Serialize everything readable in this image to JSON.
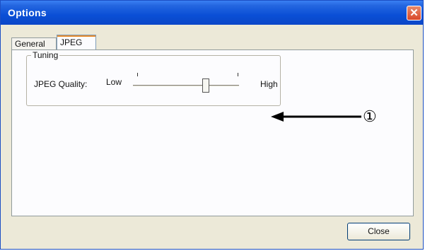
{
  "window": {
    "title": "Options",
    "close_glyph": "✕"
  },
  "tabs": [
    {
      "label": "General",
      "selected": false
    },
    {
      "label": "JPEG",
      "selected": true
    }
  ],
  "tuning": {
    "group_label": "Tuning",
    "quality_label": "JPEG Quality:",
    "low_label": "Low",
    "high_label": "High",
    "slider_value_fraction": 0.7
  },
  "annotation": {
    "marker": "①"
  },
  "footer": {
    "close_label": "Close"
  },
  "colors": {
    "titlebar": "#0a4fd6",
    "dialog_bg": "#ece9d8",
    "close_x": "#d9482a"
  }
}
